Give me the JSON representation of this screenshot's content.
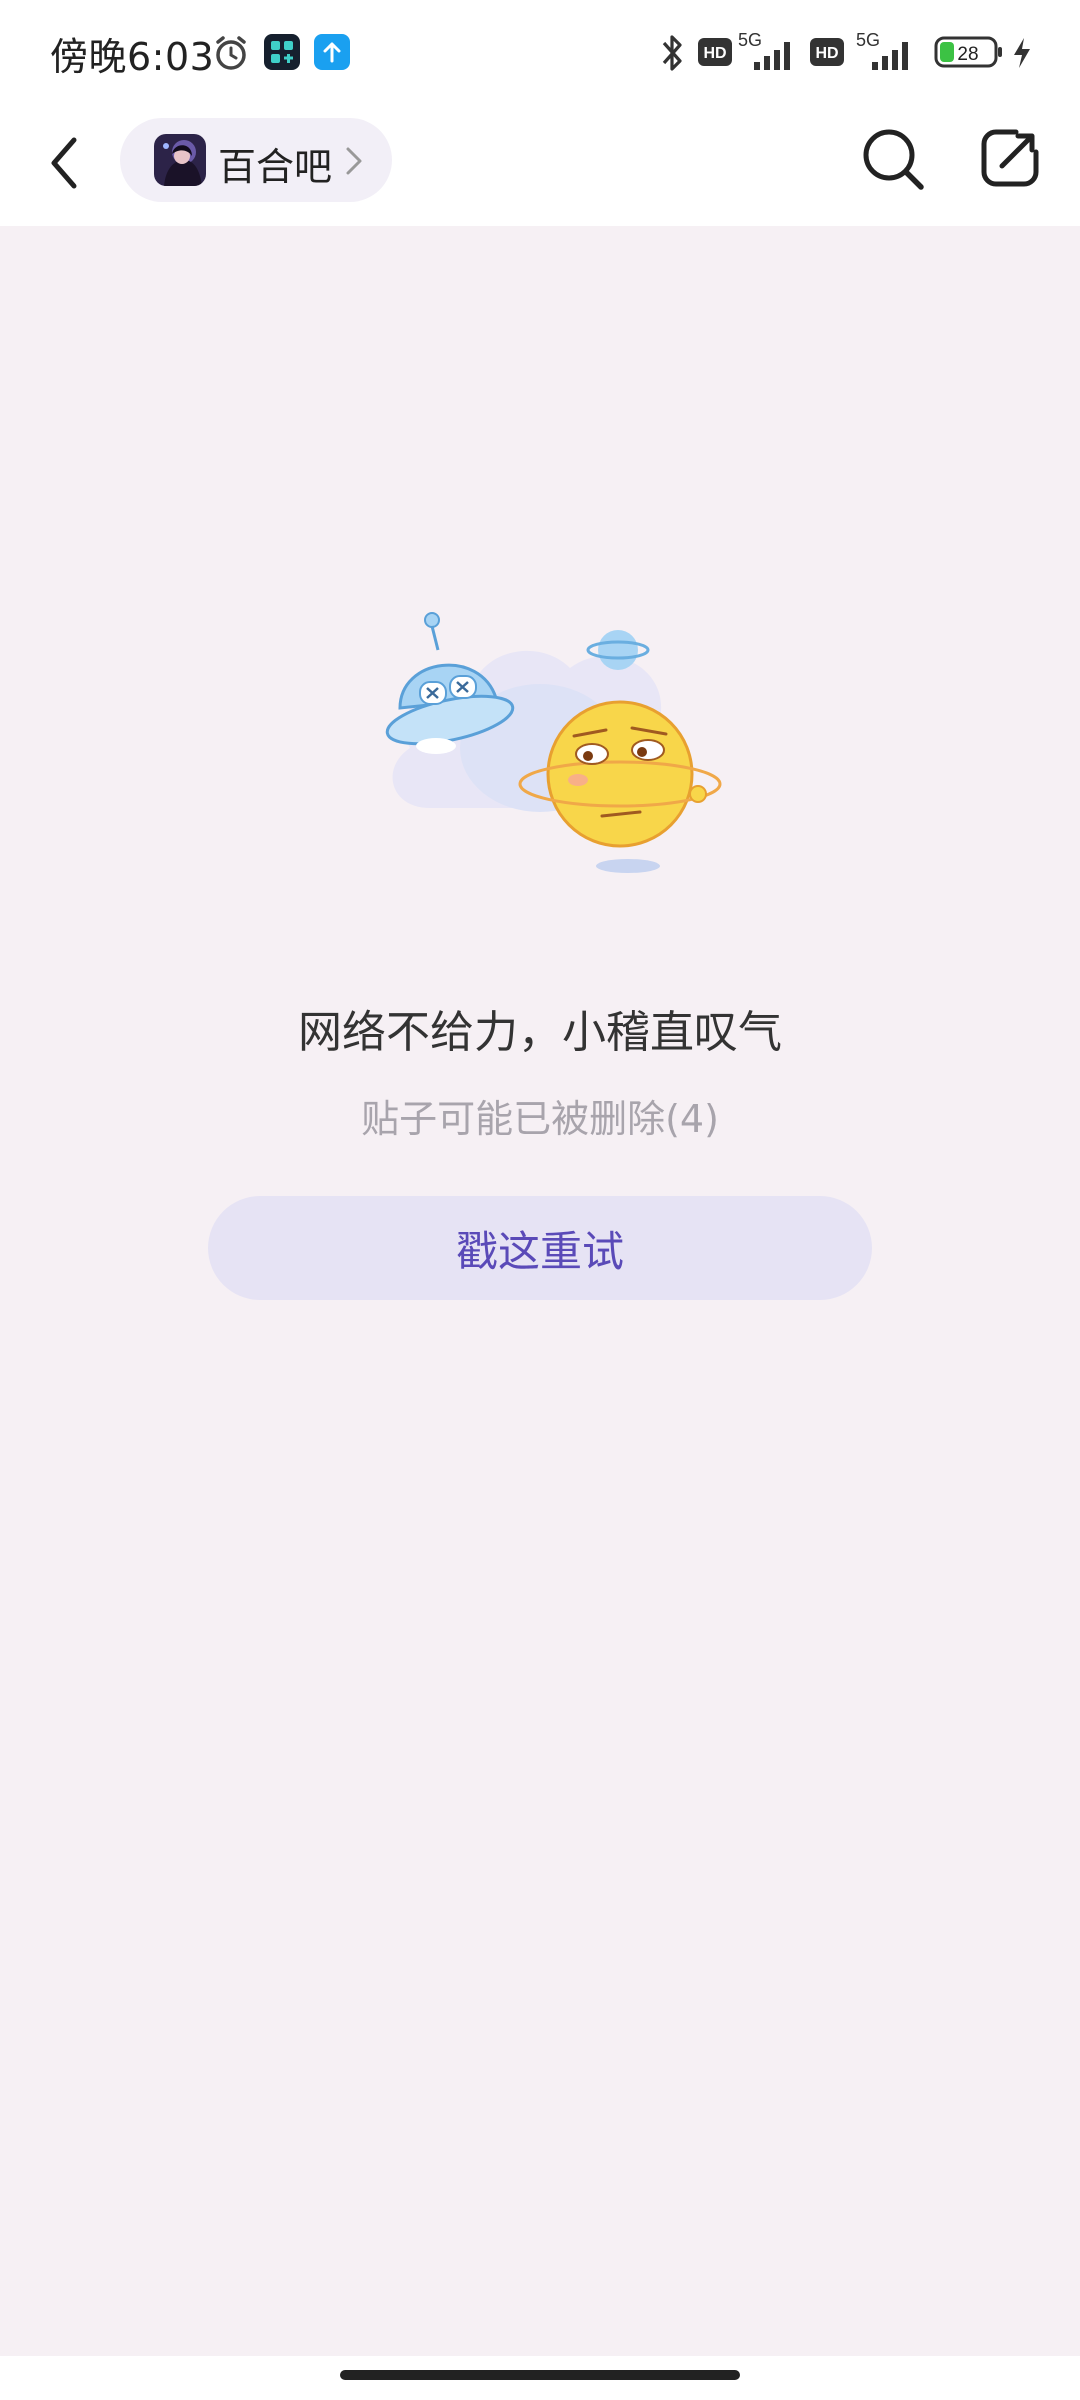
{
  "status_bar": {
    "time": "傍晚6:03",
    "icons": [
      "alarm-icon",
      "app-icon",
      "upload-icon",
      "bluetooth-icon",
      "hd-icon",
      "5g-signal-icon",
      "hd-icon",
      "5g-signal-icon",
      "battery-icon",
      "charging-icon"
    ],
    "network_1": "5G",
    "network_2": "5G",
    "hd_label": "HD",
    "battery_level": "28"
  },
  "header": {
    "forum_name": "百合吧",
    "icons": [
      "back-icon",
      "chevron-right-icon",
      "search-icon",
      "share-icon"
    ]
  },
  "error": {
    "title": "网络不给力，小稽直叹气",
    "subtitle": "贴子可能已被删除(4)",
    "retry_label": "戳这重试"
  },
  "colors": {
    "background": "#f6f0f4",
    "accent": "#5a4ab8",
    "button_bg": "#e6e3f4"
  }
}
